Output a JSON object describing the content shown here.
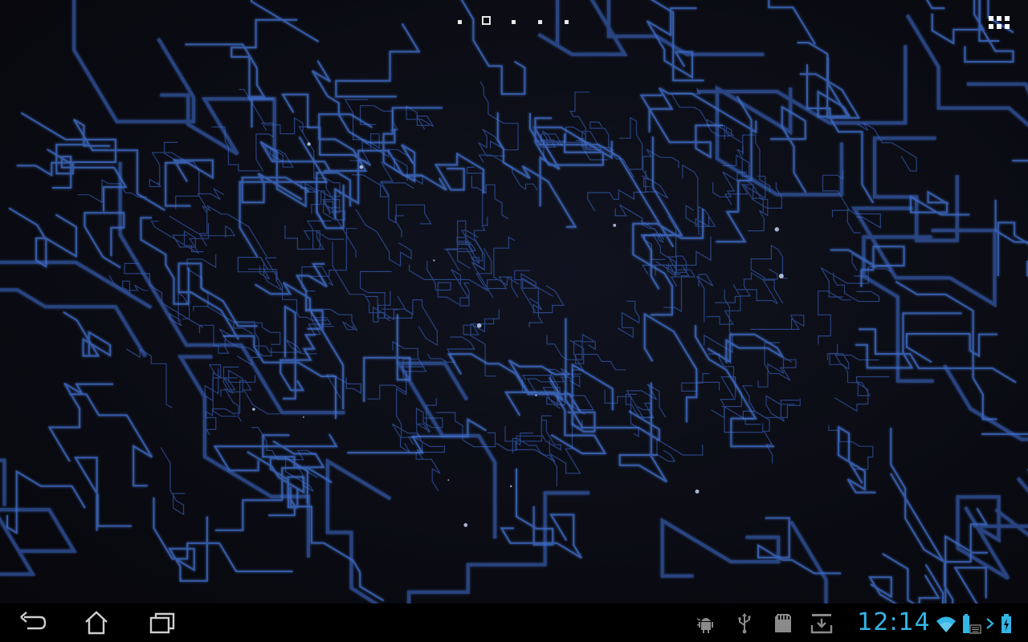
{
  "home_screen": {
    "wallpaper": "blue-circuit-live-wallpaper",
    "page_indicator": {
      "page_count": 5,
      "current_page": 2
    },
    "apps_button": {
      "icon": "all-apps-grid-icon"
    }
  },
  "system_bar": {
    "navigation": {
      "back": {
        "icon": "back-arrow-icon"
      },
      "home": {
        "icon": "home-icon"
      },
      "recent_apps": {
        "icon": "recent-apps-icon"
      }
    },
    "notifications": [
      {
        "icon": "android-debug-icon"
      },
      {
        "icon": "usb-icon"
      },
      {
        "icon": "sd-card-icon"
      },
      {
        "icon": "download-tray-icon"
      }
    ],
    "clock": "12:14",
    "status": {
      "wifi": "wifi-icon",
      "keyboard_battery": "keyboard-dock-battery-icon",
      "charging": "charging-chevron-icon",
      "battery": "battery-charging-icon"
    },
    "colors": {
      "accent": "#33b5e5",
      "icon_gray": "#9a9a9a",
      "bar_background": "#000000"
    }
  }
}
